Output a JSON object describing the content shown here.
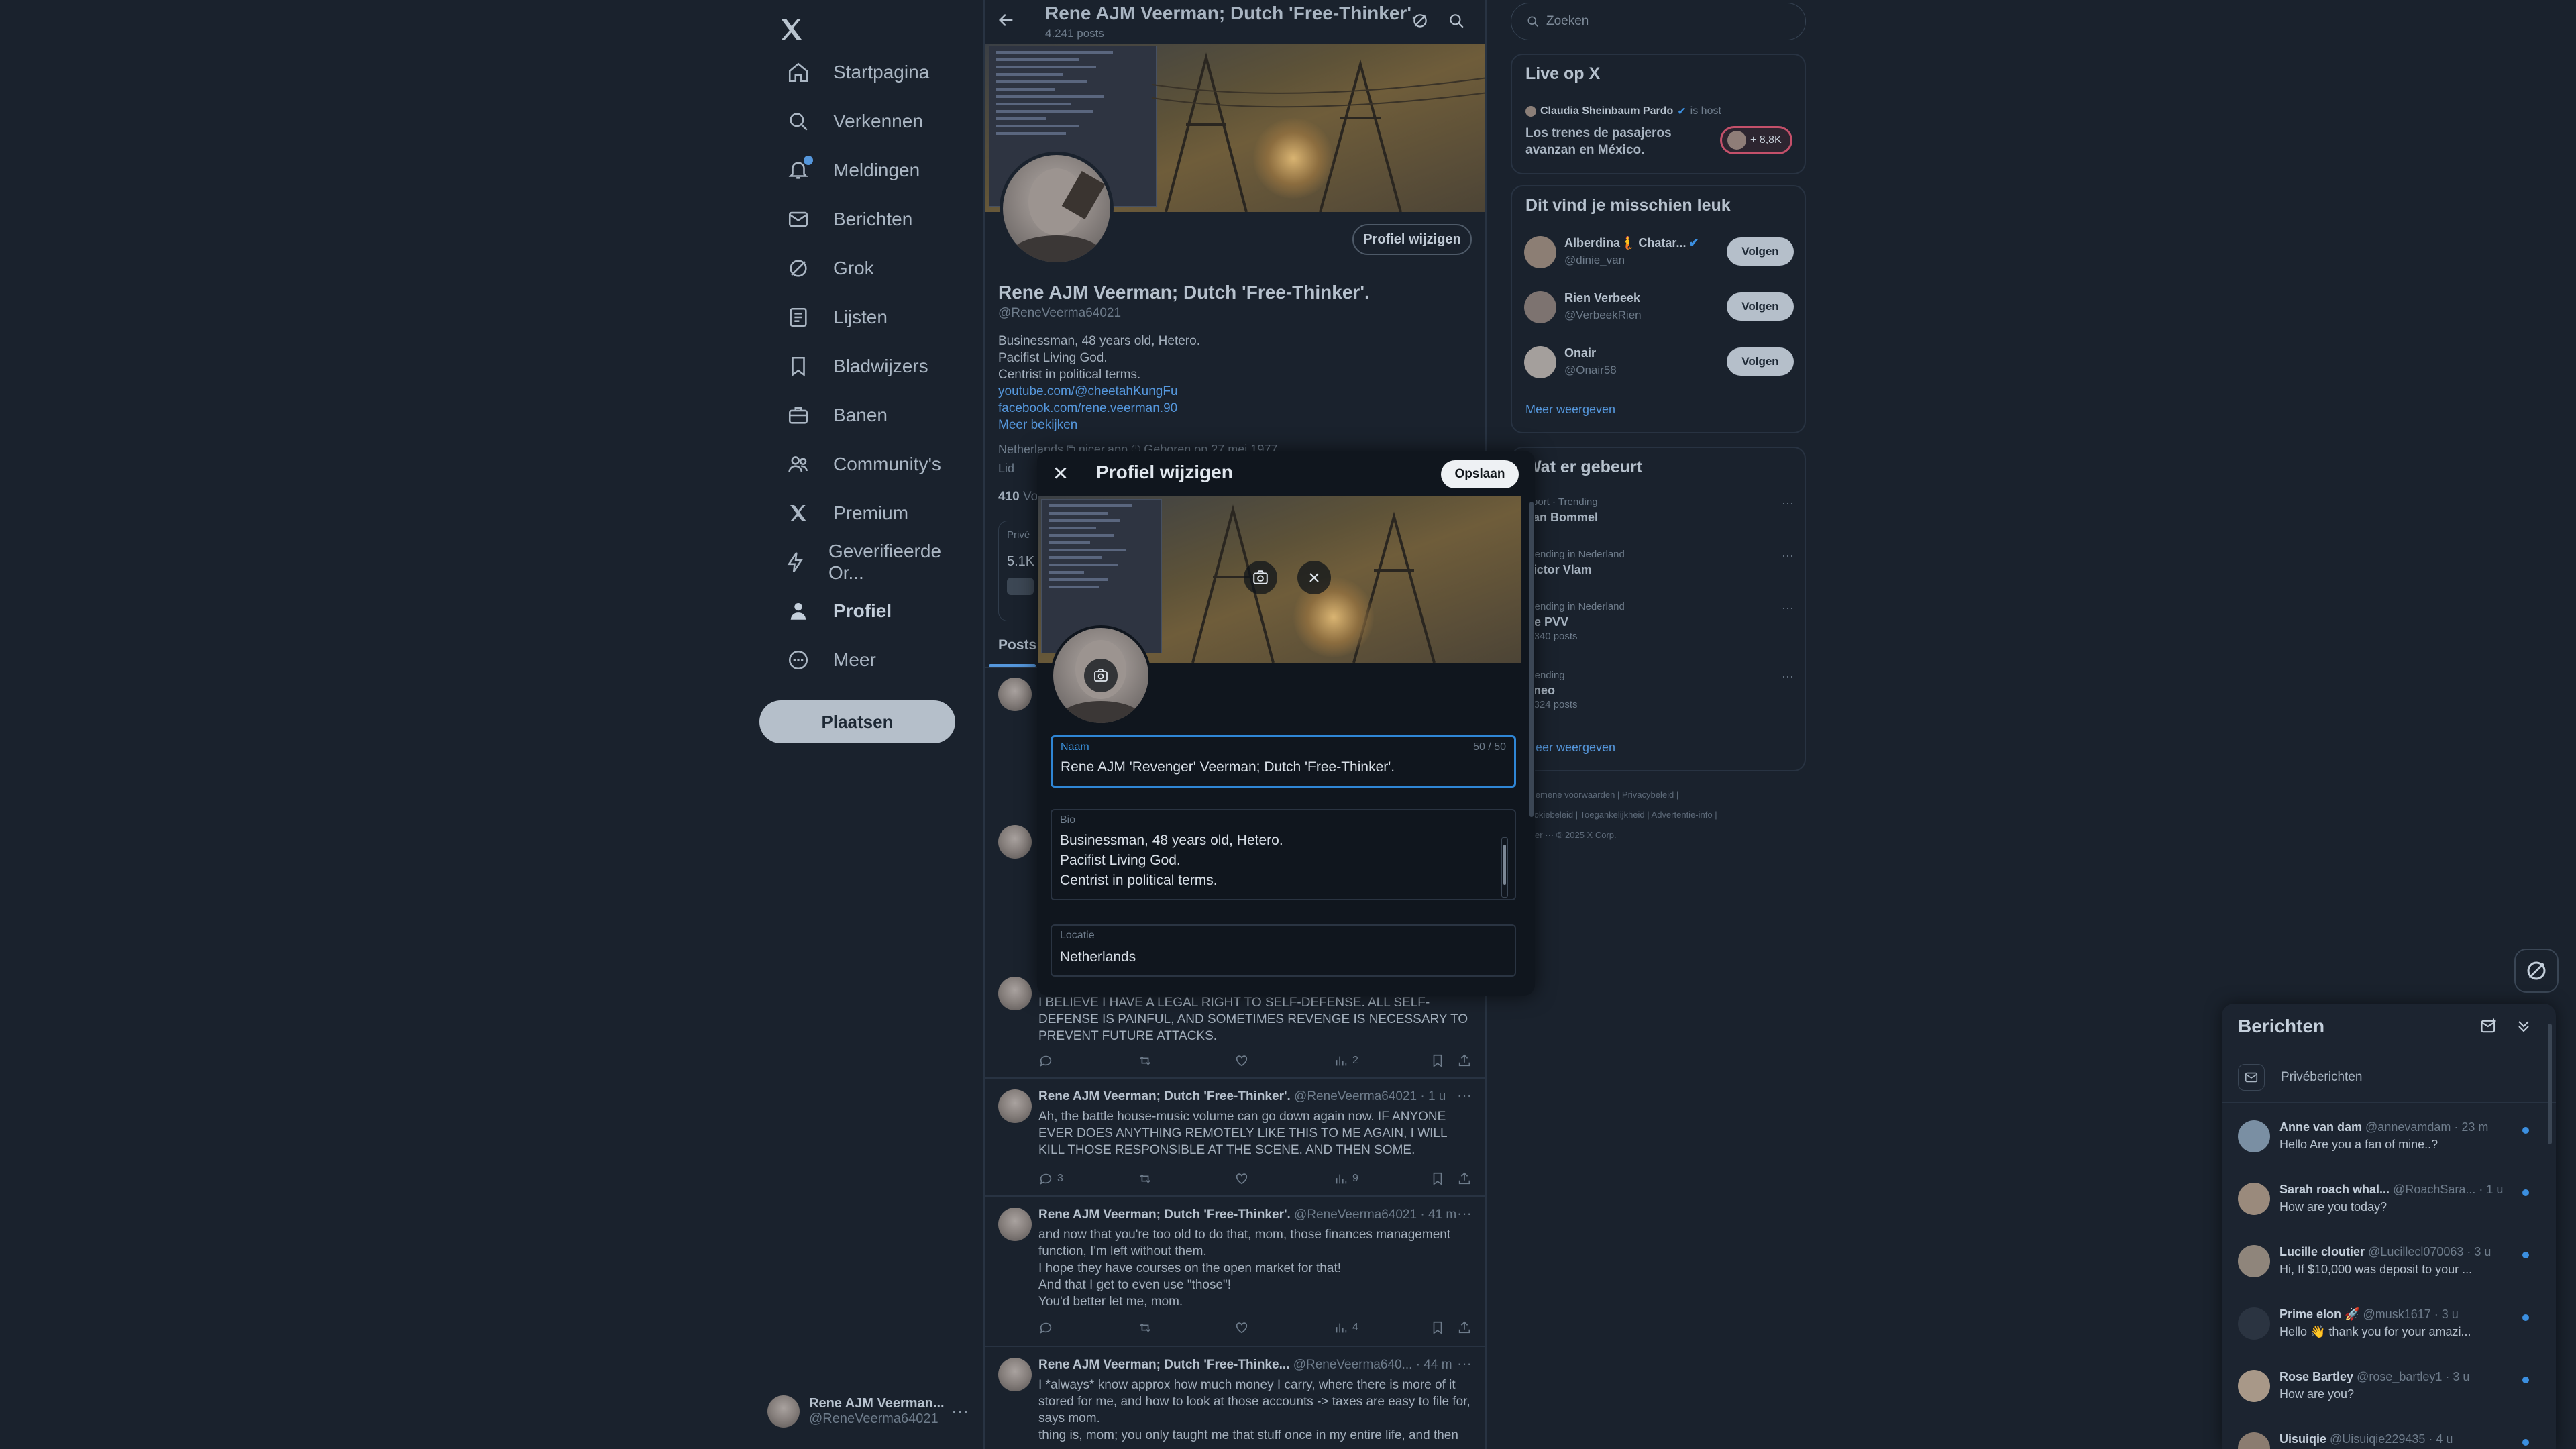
{
  "nav": {
    "items": [
      {
        "label": "Startpagina",
        "icon": "home-icon"
      },
      {
        "label": "Verkennen",
        "icon": "search-icon"
      },
      {
        "label": "Meldingen",
        "icon": "bell-icon"
      },
      {
        "label": "Berichten",
        "icon": "mail-icon"
      },
      {
        "label": "Grok",
        "icon": "grok-icon"
      },
      {
        "label": "Lijsten",
        "icon": "list-icon"
      },
      {
        "label": "Bladwijzers",
        "icon": "bookmark-icon"
      },
      {
        "label": "Banen",
        "icon": "briefcase-icon"
      },
      {
        "label": "Community's",
        "icon": "people-icon"
      },
      {
        "label": "Premium",
        "icon": "x-logo-icon"
      },
      {
        "label": "Geverifieerde Or...",
        "icon": "lightning-icon"
      },
      {
        "label": "Profiel",
        "icon": "person-icon"
      },
      {
        "label": "Meer",
        "icon": "more-circle-icon"
      }
    ],
    "post_button": "Plaatsen",
    "account": {
      "name": "Rene AJM Veerman...",
      "handle": "@ReneVeerma64021",
      "more": "···"
    }
  },
  "header": {
    "title": "Rene AJM Veerman; Dutch 'Free-Thinker'.",
    "count": "4.241 posts"
  },
  "profile": {
    "edit_button": "Profiel wijzigen",
    "name": "Rene AJM Veerman; Dutch 'Free-Thinker'.",
    "handle": "@ReneVeerma64021",
    "bio_lines": [
      "Businessman, 48 years old, Hetero.",
      "Pacifist Living God.",
      "Centrist in political terms."
    ],
    "links": [
      "youtube.com/@cheetahKungFu",
      "facebook.com/rene.veerman.90"
    ],
    "more_link": "Meer bekijken",
    "meta": "Netherlands   ⧉ nicer.app   ◷ Geboren op 27 mei 1977",
    "joined": "Lid",
    "follows_count": "410",
    "follows_label": "Vo",
    "promo_a": "Privé",
    "promo_b": "5.1K"
  },
  "tabs": {
    "posts": "Posts"
  },
  "tweets": [
    {
      "name": "",
      "meta": "",
      "text": "I BELIEVE I HAVE A LEGAL RIGHT TO SELF-DEFENSE. ALL SELF-DEFENSE IS PAINFUL, AND SOMETIMES REVENGE IS NECESSARY TO PREVENT FUTURE ATTACKS.",
      "replies": "",
      "views": "2"
    },
    {
      "name": "Rene AJM Veerman; Dutch 'Free-Thinker'.",
      "meta": "@ReneVeerma64021 · 1 u",
      "text": "Ah, the battle house-music volume can go down again now. IF ANYONE EVER DOES ANYTHING REMOTELY LIKE THIS TO ME AGAIN, I WILL KILL THOSE RESPONSIBLE AT THE SCENE. AND THEN SOME.",
      "replies": "3",
      "views": "9"
    },
    {
      "name": "Rene AJM Veerman; Dutch 'Free-Thinker'.",
      "meta": "@ReneVeerma64021 · 41 m",
      "text": "and now that you're too old to do that, mom, those finances management function, I'm left without them.\nI hope they have courses on the open market for that!\nAnd that I get to even use \"those\"!\nYou'd better let me, mom.",
      "replies": "",
      "views": "4"
    },
    {
      "name": "Rene AJM Veerman; Dutch 'Free-Thinke...",
      "meta": "@ReneVeerma640... · 44 m",
      "text": "I *always* know approx how much money I carry, where there is more of it stored for me, and how to look at those accounts -> taxes are easy to file for, says mom.\nthing is, mom; you only taught me that stuff once in my entire life, and then",
      "replies": "",
      "views": ""
    }
  ],
  "right": {
    "search_placeholder": "Zoeken",
    "live": {
      "title": "Live op X",
      "host_name": "Claudia Sheinbaum Pardo",
      "host_label": "is host",
      "text": "Los trenes de pasajeros avanzan en México.",
      "badge": "+ 8,8K"
    },
    "suggestions": {
      "title": "Dit vind je misschien leuk",
      "items": [
        {
          "name": "Alberdina🧜 Chatar...",
          "handle": "@dinie_van",
          "button": "Volgen",
          "verified": true
        },
        {
          "name": "Rien Verbeek",
          "handle": "@VerbeekRien",
          "button": "Volgen",
          "verified": false
        },
        {
          "name": "Onair",
          "handle": "@Onair58",
          "button": "Volgen",
          "verified": false
        }
      ],
      "more": "Meer weergeven"
    },
    "trends": {
      "title": "Wat er gebeurt",
      "items": [
        {
          "category": "Sport · Trending",
          "title": "Van Bommel",
          "count": ""
        },
        {
          "category": "Trending in Nederland",
          "title": "Victor Vlam",
          "count": ""
        },
        {
          "category": "Trending in Nederland",
          "title": "De PVV",
          "count": "1.340 posts"
        },
        {
          "category": "Trending",
          "title": "Sneo",
          "count": "1.324 posts"
        }
      ],
      "more": "Meer weergeven"
    },
    "footer": {
      "line1": "Algemene voorwaarden  |  Privacybeleid  |",
      "line2": "Cookiebeleid  |  Toegankelijkheid  |  Advertentie-info  |",
      "line3": "Meer ···   © 2025 X Corp."
    }
  },
  "modal": {
    "title": "Profiel wijzigen",
    "save": "Opslaan",
    "name_label": "Naam",
    "name_count": "50 / 50",
    "name_value": "Rene AJM 'Revenger' Veerman; Dutch 'Free-Thinker'.",
    "bio_label": "Bio",
    "bio_value": "Businessman, 48 years old, Hetero.\nPacifist Living God.\nCentrist in political terms.",
    "location_label": "Locatie",
    "location_value": "Netherlands"
  },
  "messages": {
    "title": "Berichten",
    "requests": "Privéberichten",
    "items": [
      {
        "name": "Anne van dam",
        "handle": "@annevamdam · 23 m",
        "msg": "Hello Are you a fan of mine..?",
        "avatar_color": "#7a8fa3"
      },
      {
        "name": "Sarah roach whal...",
        "handle": "@RoachSara... · 1 u",
        "msg": "How are you today?",
        "avatar_color": "#9a8a7c"
      },
      {
        "name": "Lucille cloutier",
        "handle": "@Lucillecl070063 · 3 u",
        "msg": "Hi, If $10,000 was deposit to your ...",
        "avatar_color": "#8f857b"
      },
      {
        "name": "Prime elon 🚀",
        "handle": "@musk1617 · 3 u",
        "msg": "Hello 👋 thank you for your amazi...",
        "avatar_color": "#2b3441"
      },
      {
        "name": "Rose Bartley",
        "handle": "@rose_bartley1 · 3 u",
        "msg": "How are you?",
        "avatar_color": "#a89888"
      },
      {
        "name": "Uisuiqie",
        "handle": "@Uisuiqie229435 · 4 u",
        "msg": "",
        "avatar_color": "#8b7c70"
      }
    ]
  },
  "colors": {
    "accent": "#1d9bf0",
    "bg": "#1a222d",
    "focus": "#2f86d6"
  }
}
